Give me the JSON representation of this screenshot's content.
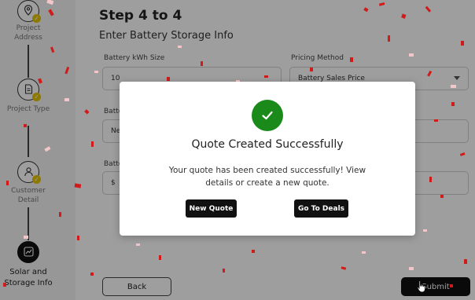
{
  "sidebar": {
    "steps": [
      {
        "label_lines": [
          "Project",
          "Address"
        ],
        "icon": "location-pin-icon",
        "completed": true
      },
      {
        "label_lines": [
          "Project Type",
          ""
        ],
        "icon": "document-icon",
        "completed": true
      },
      {
        "label_lines": [
          "Customer",
          "Detail"
        ],
        "icon": "user-icon",
        "completed": true
      },
      {
        "label_lines": [
          "Solar and",
          "Storage Info"
        ],
        "icon": "chart-icon",
        "completed": false,
        "active": true
      }
    ]
  },
  "main": {
    "step_title": "Step 4 to 4",
    "subtitle": "Enter Battery Storage Info",
    "fields": {
      "battery_kwh": {
        "label": "Battery kWh Size",
        "value": "10"
      },
      "pricing_method": {
        "label": "Pricing Method",
        "value": "Battery Sales Price"
      },
      "row2_left": {
        "label": "Batte",
        "value": "Ne"
      },
      "row3_left": {
        "label": "Batte",
        "value": "$"
      }
    },
    "back_label": "Back",
    "submit_label": "Submit"
  },
  "modal": {
    "title": "Quote Created Successfully",
    "message": "Your quote has been created successfully! View details or create a new quote.",
    "new_quote_label": "New Quote",
    "go_to_deals_label": "Go To Deals",
    "success_color": "#1a8a1a"
  },
  "colors": {
    "confetti": "#d11a1a",
    "step_check": "#e4c400"
  }
}
